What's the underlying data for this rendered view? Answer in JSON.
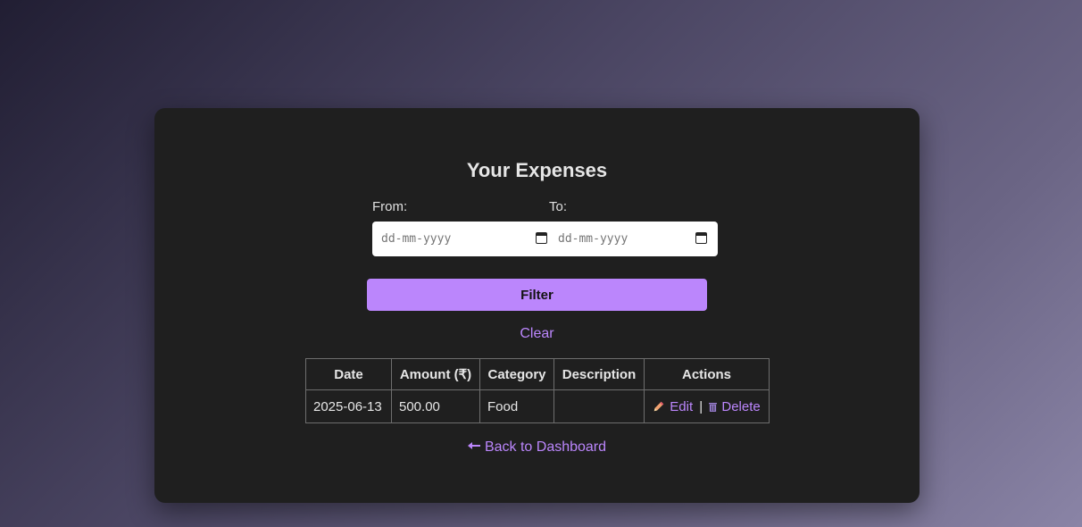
{
  "page": {
    "title": "Your Expenses"
  },
  "filter": {
    "from_label": "From:",
    "to_label": "To:",
    "from_placeholder": "dd-mm-yyyy",
    "to_placeholder": "dd-mm-yyyy",
    "from_icon": "calendar-icon",
    "to_icon": "calendar-icon",
    "filter_button": "Filter",
    "clear_link": "Clear"
  },
  "table": {
    "headers": [
      "Date",
      "Amount (₹)",
      "Category",
      "Description",
      "Actions"
    ],
    "rows": [
      {
        "date": "2025-06-13",
        "amount": "500.00",
        "category": "Food",
        "description": "",
        "edit_label": "Edit",
        "separator": "|",
        "delete_label": "Delete"
      }
    ]
  },
  "footer": {
    "back_link": "Back to Dashboard",
    "back_icon": "arrow-left-icon"
  },
  "colors": {
    "accent": "#bb86fc",
    "card_bg": "#1f1f1f",
    "text": "#e6e6e6"
  }
}
